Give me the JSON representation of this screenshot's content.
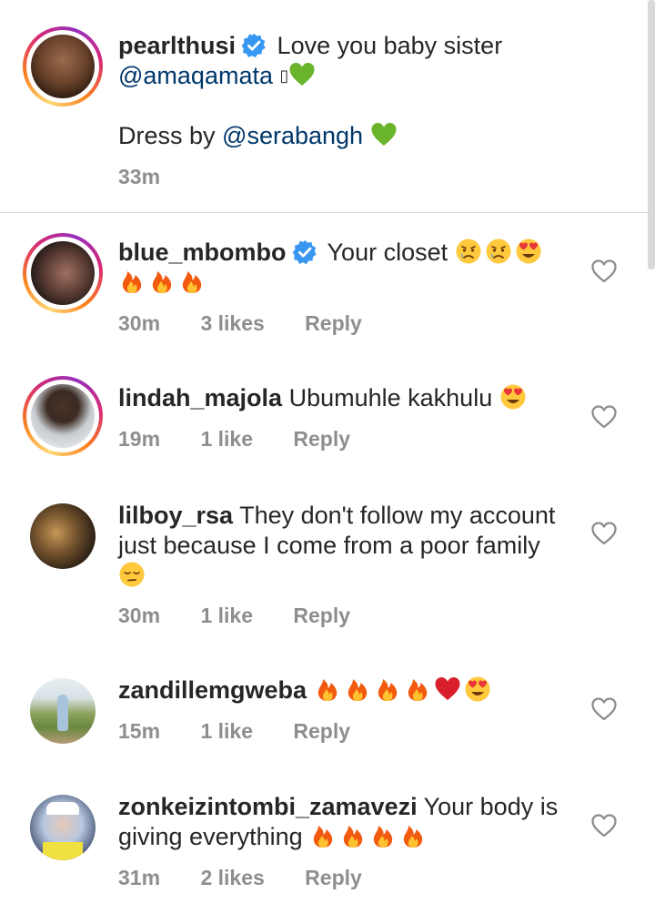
{
  "caption": {
    "username": "pearlthusi",
    "text": "Love you baby sister",
    "mention": "@amaqamata",
    "emoji_box": "▯",
    "line2_prefix": "Dress by ",
    "line2_mention": "@serabangh",
    "time": "33m"
  },
  "comments": [
    {
      "username": "blue_mbombo",
      "text": "Your closet",
      "time": "30m",
      "likes": "3 likes",
      "reply": "Reply"
    },
    {
      "username": "lindah_majola",
      "text": "Ubumuhle kakhulu",
      "time": "19m",
      "likes": "1 like",
      "reply": "Reply"
    },
    {
      "username": "lilboy_rsa",
      "text": "They don't follow my account",
      "text2": "just because I come from a poor family",
      "time": "30m",
      "likes": "1 like",
      "reply": "Reply"
    },
    {
      "username": "zandillemgweba",
      "text": "",
      "time": "15m",
      "likes": "1 like",
      "reply": "Reply"
    },
    {
      "username": "zonkeizintombi_zamavezi",
      "text": "Your body is",
      "text2": "giving everything",
      "time": "31m",
      "likes": "2 likes",
      "reply": "Reply"
    }
  ],
  "icons": {
    "verified": "verified-badge-icon",
    "heart": "heart-outline-icon",
    "green_heart": "green-heart-emoji",
    "fire": "fire-emoji",
    "crying": "crying-face-emoji",
    "heart_eyes": "heart-eyes-emoji",
    "red_heart": "red-heart-emoji",
    "pensive": "pensive-face-emoji"
  },
  "colors": {
    "mention": "#00376b",
    "verified": "#3897f0",
    "meta": "#8e8e8e",
    "divider": "#dbdbdb"
  }
}
